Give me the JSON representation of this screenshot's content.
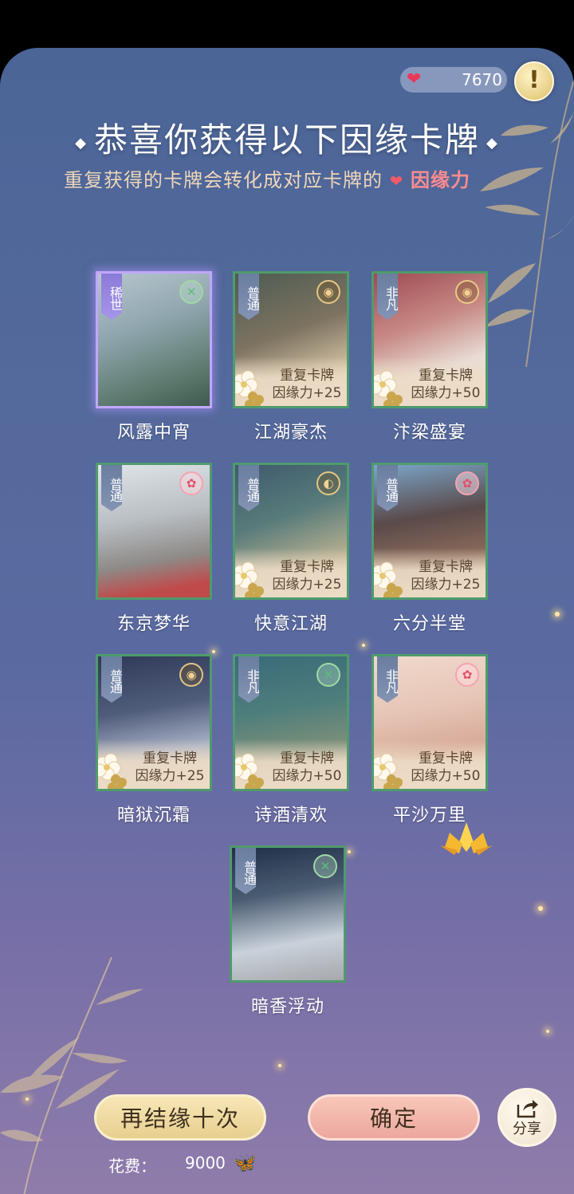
{
  "resource": {
    "count": "7670"
  },
  "header": {
    "title": "恭喜你获得以下因缘卡牌",
    "subtitle_prefix": "重复获得的卡牌会转化成对应卡牌的",
    "subtitle_emphasis": "因缘力"
  },
  "info_button": {
    "label": "!"
  },
  "cards": [
    {
      "name": "风露中宵",
      "rarity": "稀世",
      "emblem": "green-icon",
      "duplicate": false,
      "line1": "",
      "line2": ""
    },
    {
      "name": "江湖豪杰",
      "rarity": "普通",
      "emblem": "gold-icon",
      "duplicate": true,
      "line1": "重复卡牌",
      "line2": "因缘力+25"
    },
    {
      "name": "汴梁盛宴",
      "rarity": "非凡",
      "emblem": "gold-icon",
      "duplicate": true,
      "line1": "重复卡牌",
      "line2": "因缘力+50"
    },
    {
      "name": "东京梦华",
      "rarity": "普通",
      "emblem": "pink-icon",
      "duplicate": false,
      "line1": "",
      "line2": ""
    },
    {
      "name": "快意江湖",
      "rarity": "普通",
      "emblem": "fan-icon",
      "duplicate": true,
      "line1": "重复卡牌",
      "line2": "因缘力+25"
    },
    {
      "name": "六分半堂",
      "rarity": "普通",
      "emblem": "pink-icon",
      "duplicate": true,
      "line1": "重复卡牌",
      "line2": "因缘力+25"
    },
    {
      "name": "暗狱沉霜",
      "rarity": "普通",
      "emblem": "gold-icon",
      "duplicate": true,
      "line1": "重复卡牌",
      "line2": "因缘力+25"
    },
    {
      "name": "诗酒清欢",
      "rarity": "非凡",
      "emblem": "green-icon",
      "duplicate": true,
      "line1": "重复卡牌",
      "line2": "因缘力+50"
    },
    {
      "name": "平沙万里",
      "rarity": "非凡",
      "emblem": "pink-icon",
      "duplicate": true,
      "line1": "重复卡牌",
      "line2": "因缘力+50"
    },
    {
      "name": "暗香浮动",
      "rarity": "普通",
      "emblem": "green-icon",
      "duplicate": false,
      "line1": "",
      "line2": ""
    }
  ],
  "buttons": {
    "again": "再结缘十次",
    "ok": "确定",
    "share": "分享"
  },
  "cost": {
    "label": "花费：",
    "value": "9000"
  },
  "colors": {
    "accent_pink": "#f05a66",
    "title_gold": "#efd6b9",
    "card_border": "#4f9b6d",
    "rare_border": "#bfa7ff"
  }
}
